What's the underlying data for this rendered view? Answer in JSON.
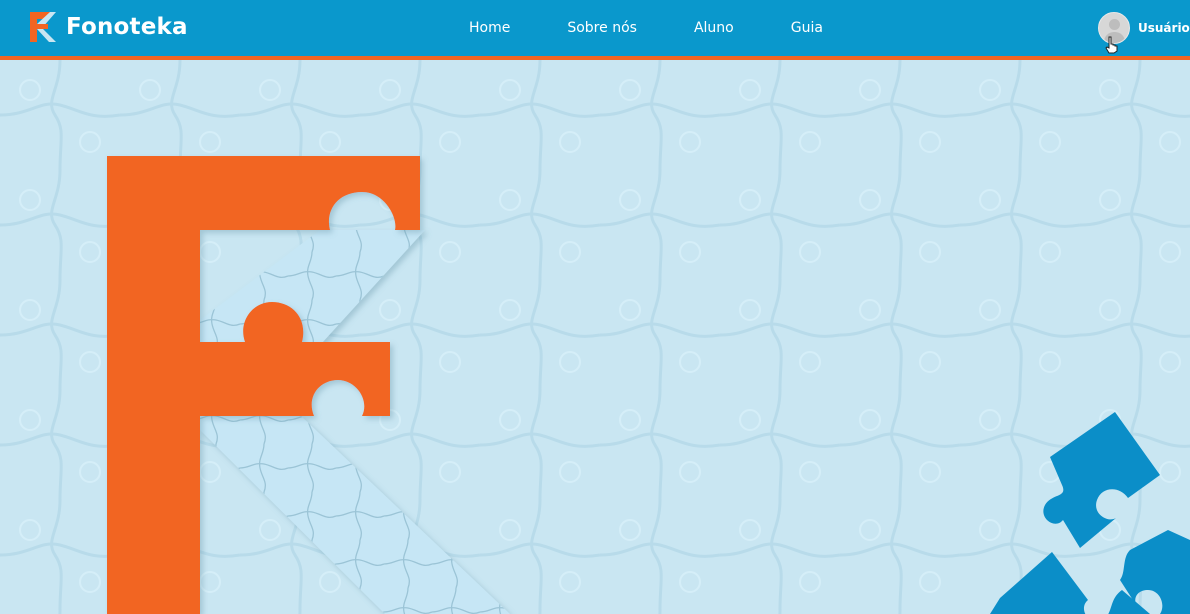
{
  "brand": {
    "name": "Fonoteka",
    "logo_icon": "fonoteka-f-logo-icon"
  },
  "nav": {
    "items": [
      {
        "label": "Home"
      },
      {
        "label": "Sobre nós"
      },
      {
        "label": "Aluno"
      },
      {
        "label": "Guia"
      }
    ]
  },
  "user": {
    "label": "Usuário",
    "avatar_icon": "user-avatar-icon"
  },
  "colors": {
    "navbar": "#0a98cc",
    "accent": "#f26522",
    "background": "#c9e6f2",
    "puzzle_light": "#c6e6f5",
    "puzzle_blue": "#0b8ec8"
  }
}
